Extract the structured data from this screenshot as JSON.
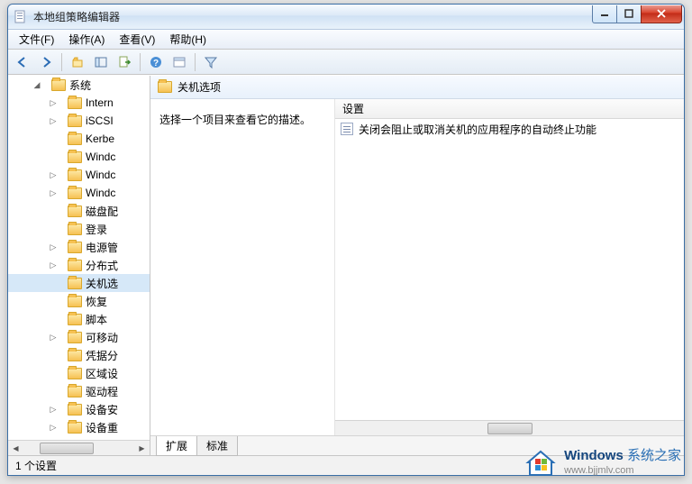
{
  "window": {
    "title": "本地组策略编辑器"
  },
  "menu": {
    "file": "文件(F)",
    "action": "操作(A)",
    "view": "查看(V)",
    "help": "帮助(H)"
  },
  "tree": {
    "root": "系统",
    "items": [
      {
        "label": "Intern",
        "expandable": true
      },
      {
        "label": "iSCSI",
        "expandable": true
      },
      {
        "label": "Kerbe",
        "expandable": false
      },
      {
        "label": "Windc",
        "expandable": false
      },
      {
        "label": "Windc",
        "expandable": true
      },
      {
        "label": "Windc",
        "expandable": true
      },
      {
        "label": "磁盘配",
        "expandable": false
      },
      {
        "label": "登录",
        "expandable": false
      },
      {
        "label": "电源管",
        "expandable": true
      },
      {
        "label": "分布式",
        "expandable": true
      },
      {
        "label": "关机选",
        "expandable": false,
        "selected": true
      },
      {
        "label": "恢复",
        "expandable": false
      },
      {
        "label": "脚本",
        "expandable": false
      },
      {
        "label": "可移动",
        "expandable": true
      },
      {
        "label": "凭据分",
        "expandable": false
      },
      {
        "label": "区域设",
        "expandable": false
      },
      {
        "label": "驱动程",
        "expandable": false
      },
      {
        "label": "设备安",
        "expandable": true
      },
      {
        "label": "设备重",
        "expandable": true
      }
    ]
  },
  "right": {
    "path_title": "关机选项",
    "description": "选择一个项目来查看它的描述。",
    "header": "设置",
    "rows": [
      {
        "text": "关闭会阻止或取消关机的应用程序的自动终止功能"
      }
    ]
  },
  "tabs": {
    "extend": "扩展",
    "standard": "标准"
  },
  "status": "1 个设置",
  "watermark": {
    "line1a": "Windows",
    "line1b": " 系统之家",
    "line2": "www.bjjmlv.com"
  }
}
